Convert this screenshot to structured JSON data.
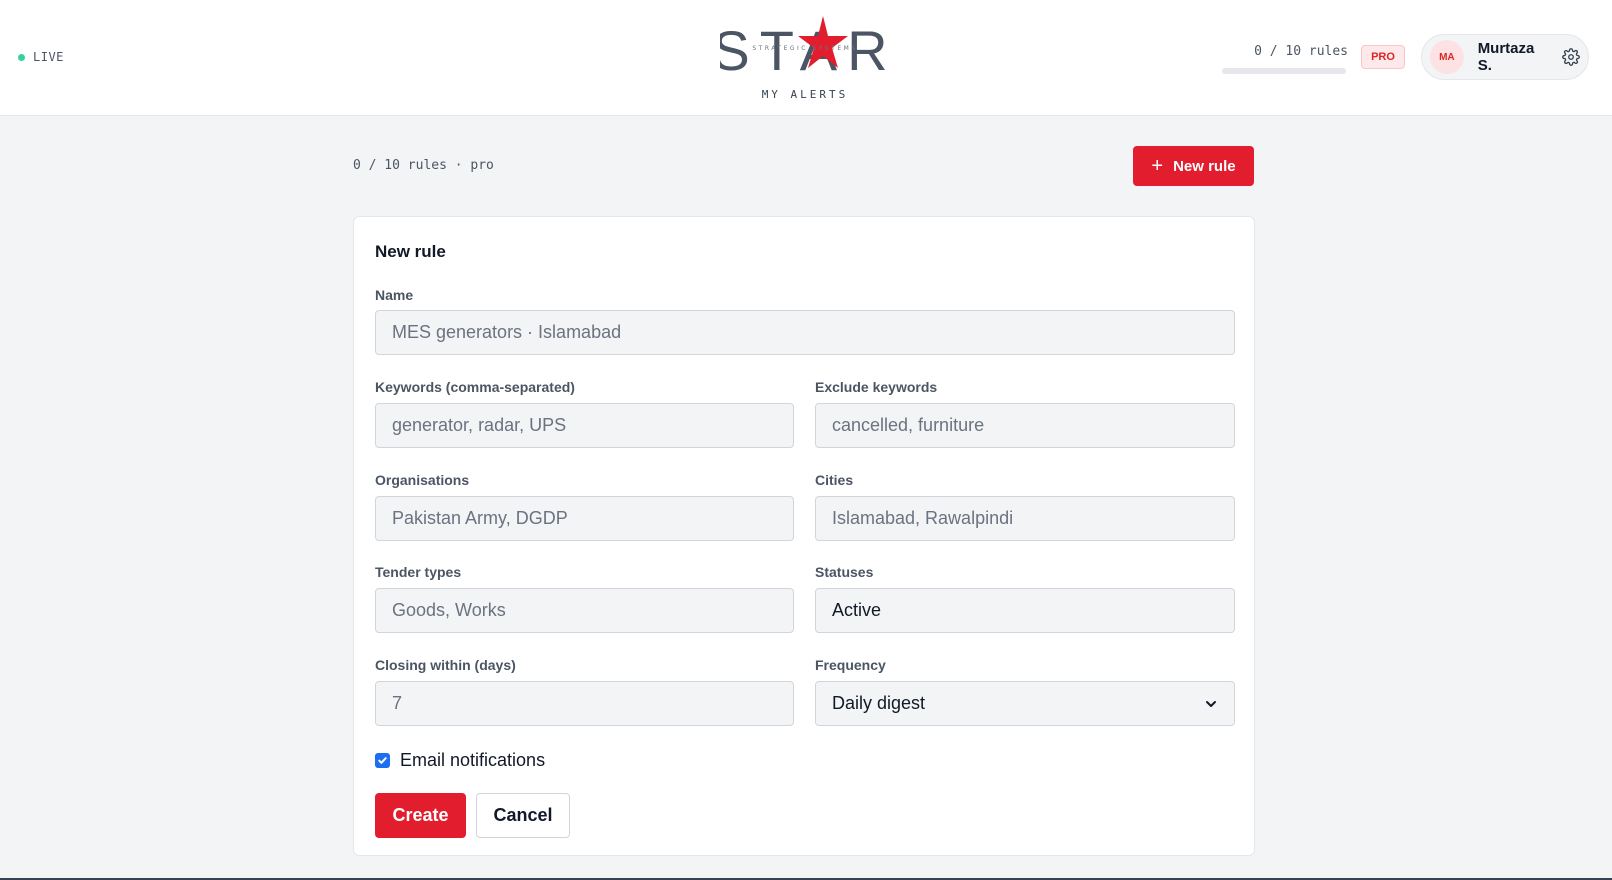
{
  "header": {
    "live_label": "LIVE",
    "logo_text": "STAR",
    "logo_tagline": "STRATEGIC SYSTEMS",
    "logo_subtitle": "MY ALERTS",
    "usage_text": "0 / 10 rules",
    "usage_fraction": 0,
    "plan_badge": "PRO",
    "user_initials": "MA",
    "user_name": "Murtaza S.",
    "settings_icon": "gear-icon"
  },
  "toolbar": {
    "rules_count": "0 / 10 rules · pro",
    "new_rule_label": "New rule",
    "new_rule_icon": "plus-icon"
  },
  "form": {
    "title": "New rule",
    "name": {
      "label": "Name",
      "placeholder": "MES generators · Islamabad",
      "value": ""
    },
    "keywords": {
      "label": "Keywords (comma-separated)",
      "placeholder": "generator, radar, UPS",
      "value": ""
    },
    "exclude_keywords": {
      "label": "Exclude keywords",
      "placeholder": "cancelled, furniture",
      "value": ""
    },
    "organisations": {
      "label": "Organisations",
      "placeholder": "Pakistan Army, DGDP",
      "value": ""
    },
    "cities": {
      "label": "Cities",
      "placeholder": "Islamabad, Rawalpindi",
      "value": ""
    },
    "tender_types": {
      "label": "Tender types",
      "placeholder": "Goods, Works",
      "value": ""
    },
    "statuses": {
      "label": "Statuses",
      "value": "Active"
    },
    "closing_within": {
      "label": "Closing within (days)",
      "placeholder": "7",
      "value": ""
    },
    "frequency": {
      "label": "Frequency",
      "selected": "Daily digest"
    },
    "email_notifications": {
      "label": "Email notifications",
      "checked": true
    },
    "create_label": "Create",
    "cancel_label": "Cancel"
  },
  "colors": {
    "accent": "#e11d2e",
    "live_dot": "#34d399",
    "checkbox": "#1d6ff2"
  }
}
